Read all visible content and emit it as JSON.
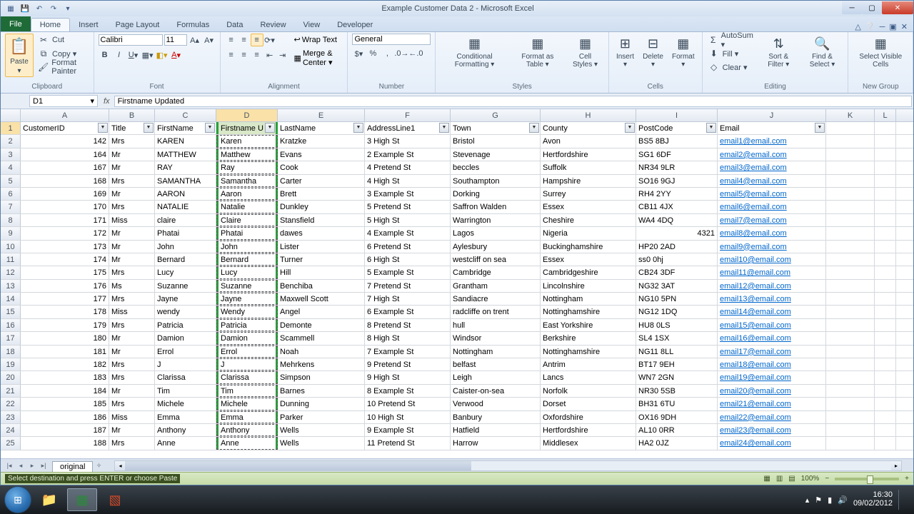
{
  "titlebar": {
    "title": "Example Customer Data 2 - Microsoft Excel"
  },
  "tabs": {
    "file": "File",
    "home": "Home",
    "insert": "Insert",
    "pageLayout": "Page Layout",
    "formulas": "Formulas",
    "data": "Data",
    "review": "Review",
    "view": "View",
    "developer": "Developer"
  },
  "ribbon": {
    "clipboard": {
      "paste": "Paste",
      "cut": "Cut",
      "copy": "Copy ▾",
      "formatPainter": "Format Painter",
      "label": "Clipboard"
    },
    "font": {
      "name": "Calibri",
      "size": "11",
      "label": "Font"
    },
    "alignment": {
      "wrap": "Wrap Text",
      "merge": "Merge & Center ▾",
      "label": "Alignment"
    },
    "number": {
      "format": "General",
      "label": "Number"
    },
    "styles": {
      "cond": "Conditional Formatting ▾",
      "table": "Format as Table ▾",
      "cell": "Cell Styles ▾",
      "label": "Styles"
    },
    "cells": {
      "insert": "Insert ▾",
      "delete": "Delete ▾",
      "format": "Format ▾",
      "label": "Cells"
    },
    "editing": {
      "autosum": "AutoSum ▾",
      "fill": "Fill ▾",
      "clear": "Clear ▾",
      "sort": "Sort & Filter ▾",
      "find": "Find & Select ▾",
      "label": "Editing"
    },
    "newgroup": {
      "select": "Select Visible Cells",
      "label": "New Group"
    }
  },
  "namebox": "D1",
  "formula": "Firstname Updated",
  "columns": [
    "A",
    "B",
    "C",
    "D",
    "E",
    "F",
    "G",
    "H",
    "I",
    "J",
    "K",
    "L"
  ],
  "headers": [
    "CustomerID",
    "Title",
    "FirstName",
    "Firstname U",
    "LastName",
    "AddressLine1",
    "Town",
    "County",
    "PostCode",
    "Email"
  ],
  "rows": [
    [
      "142",
      "Mrs",
      "KAREN",
      "Karen",
      "Kratzke",
      "3 High St",
      "Bristol",
      "Avon",
      "BS5 8BJ",
      "email1@email.com"
    ],
    [
      "164",
      "Mr",
      "MATTHEW",
      "Matthew",
      "Evans",
      "2 Example St",
      "Stevenage",
      "Hertfordshire",
      "SG1 6DF",
      "email2@email.com"
    ],
    [
      "167",
      "Mr",
      "RAY",
      "Ray",
      "Cook",
      "4 Pretend St",
      "beccles",
      "Suffolk",
      "NR34 9LR",
      "email3@email.com"
    ],
    [
      "168",
      "Mrs",
      "SAMANTHA",
      "Samantha",
      "Carter",
      "4 High St",
      "Southampton",
      "Hampshire",
      "SO16 9GJ",
      "email4@email.com"
    ],
    [
      "169",
      "Mr",
      "AARON",
      "Aaron",
      "Brett",
      "3 Example St",
      "Dorking",
      "Surrey",
      "RH4 2YY",
      "email5@email.com"
    ],
    [
      "170",
      "Mrs",
      "NATALIE",
      "Natalie",
      "Dunkley",
      "5 Pretend St",
      "Saffron Walden",
      "Essex",
      "CB11 4JX",
      "email6@email.com"
    ],
    [
      "171",
      "Miss",
      "claire",
      "Claire",
      "Stansfield",
      "5 High St",
      "Warrington",
      "Cheshire",
      "WA4 4DQ",
      "email7@email.com"
    ],
    [
      "172",
      "Mr",
      "Phatai",
      "Phatai",
      "dawes",
      "4 Example St",
      "Lagos",
      "Nigeria",
      "4321",
      "email8@email.com"
    ],
    [
      "173",
      "Mr",
      "John",
      "John",
      "Lister",
      "6 Pretend St",
      "Aylesbury",
      "Buckinghamshire",
      "HP20 2AD",
      "email9@email.com"
    ],
    [
      "174",
      "Mr",
      "Bernard",
      "Bernard",
      "Turner",
      "6 High St",
      "westcliff on sea",
      "Essex",
      "ss0 0hj",
      "email10@email.com"
    ],
    [
      "175",
      "Mrs",
      "Lucy",
      "Lucy",
      "Hill",
      "5 Example St",
      "Cambridge",
      "Cambridgeshire",
      "CB24 3DF",
      "email11@email.com"
    ],
    [
      "176",
      "Ms",
      "Suzanne",
      "Suzanne",
      "Benchiba",
      "7 Pretend St",
      "Grantham",
      "Lincolnshire",
      "NG32 3AT",
      "email12@email.com"
    ],
    [
      "177",
      "Mrs",
      "Jayne",
      "Jayne",
      "Maxwell Scott",
      "7 High St",
      "Sandiacre",
      "Nottingham",
      "NG10 5PN",
      "email13@email.com"
    ],
    [
      "178",
      "Miss",
      "wendy",
      "Wendy",
      "Angel",
      "6 Example St",
      "radcliffe on trent",
      "Nottinghamshire",
      "NG12 1DQ",
      "email14@email.com"
    ],
    [
      "179",
      "Mrs",
      "Patricia",
      "Patricia",
      "Demonte",
      "8 Pretend St",
      "hull",
      "East Yorkshire",
      "HU8 0LS",
      "email15@email.com"
    ],
    [
      "180",
      "Mr",
      "Damion",
      "Damion",
      "Scammell",
      "8 High St",
      "Windsor",
      "Berkshire",
      "SL4 1SX",
      "email16@email.com"
    ],
    [
      "181",
      "Mr",
      "Errol",
      "Errol",
      "Noah",
      "7 Example St",
      "Nottingham",
      "Nottinghamshire",
      "NG11 8LL",
      "email17@email.com"
    ],
    [
      "182",
      "Mrs",
      "J",
      "J",
      "Mehrkens",
      "9 Pretend St",
      "belfast",
      "Antrim",
      "BT17 9EH",
      "email18@email.com"
    ],
    [
      "183",
      "Mrs",
      "Clarissa",
      "Clarissa",
      "Simpson",
      "9 High St",
      "Leigh",
      "Lancs",
      "WN7 2GN",
      "email19@email.com"
    ],
    [
      "184",
      "Mr",
      "Tim",
      "Tim",
      "Barnes",
      "8 Example St",
      "Caister-on-sea",
      "Norfolk",
      "NR30 5SB",
      "email20@email.com"
    ],
    [
      "185",
      "Mrs",
      "Michele",
      "Michele",
      "Dunning",
      "10 Pretend St",
      "Verwood",
      "Dorset",
      "BH31 6TU",
      "email21@email.com"
    ],
    [
      "186",
      "Miss",
      "Emma",
      "Emma",
      "Parker",
      "10 High St",
      "Banbury",
      "Oxfordshire",
      "OX16 9DH",
      "email22@email.com"
    ],
    [
      "187",
      "Mr",
      "Anthony",
      "Anthony",
      "Wells",
      "9 Example St",
      "Hatfield",
      "Hertfordshire",
      "AL10 0RR",
      "email23@email.com"
    ],
    [
      "188",
      "Mrs",
      "Anne",
      "Anne",
      "Wells",
      "11 Pretend St",
      "Harrow",
      "Middlesex",
      "HA2 0JZ",
      "email24@email.com"
    ]
  ],
  "numericPostcodeRow": 7,
  "sheet": {
    "name": "original"
  },
  "status": {
    "msg": "Select destination and press ENTER or choose Paste",
    "zoom": "100%"
  },
  "tray": {
    "time": "16:30",
    "date": "09/02/2012"
  }
}
